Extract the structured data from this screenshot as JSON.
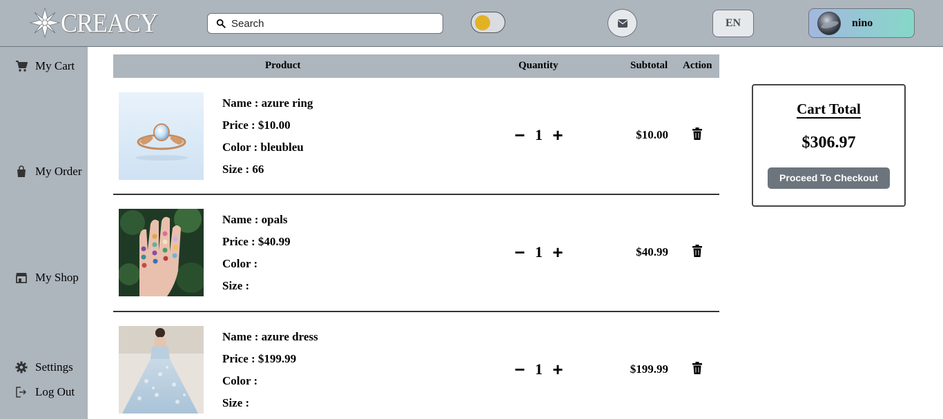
{
  "header": {
    "logo_text": "CREACY",
    "search_placeholder": "Search",
    "lang_label": "EN",
    "user_name": "nino"
  },
  "sidebar": {
    "items": [
      {
        "label": "My Cart",
        "icon": "cart-icon"
      },
      {
        "label": "My Order",
        "icon": "shopping-bag-icon"
      },
      {
        "label": "My Shop",
        "icon": "store-icon"
      },
      {
        "label": "Settings",
        "icon": "gear-icon"
      },
      {
        "label": "Log Out",
        "icon": "logout-icon"
      }
    ]
  },
  "table": {
    "headers": {
      "product": "Product",
      "quantity": "Quantity",
      "subtotal": "Subtotal",
      "action": "Action"
    },
    "rows": [
      {
        "name": "Name : azure ring",
        "price": "Price : $10.00",
        "color": "Color : bleubleu",
        "size": "Size : 66",
        "qty": "1",
        "subtotal": "$10.00",
        "image": "ring-photo"
      },
      {
        "name": "Name : opals",
        "price": "Price : $40.99",
        "color": "Color :",
        "size": "Size :",
        "qty": "1",
        "subtotal": "$40.99",
        "image": "opal-rings-photo"
      },
      {
        "name": "Name : azure dress",
        "price": "Price : $199.99",
        "color": "Color :",
        "size": "Size :",
        "qty": "1",
        "subtotal": "$199.99",
        "image": "dress-photo"
      }
    ],
    "minus_label": "−",
    "plus_label": "+"
  },
  "cart_total": {
    "title": "Cart Total",
    "amount": "$306.97",
    "checkout_label": "Proceed To Checkout"
  },
  "colors": {
    "header_bg": "#adb5bd",
    "toggle_knob": "#e3b223",
    "checkout_bg": "#6c757d"
  }
}
